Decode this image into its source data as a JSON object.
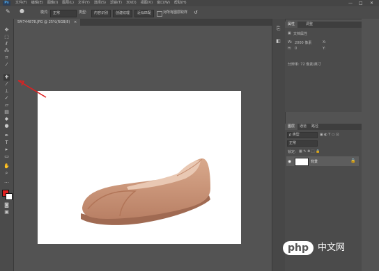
{
  "menubar": {
    "logo": "Ps",
    "items": [
      "文件(F)",
      "编辑(E)",
      "图像(I)",
      "图层(L)",
      "文字(Y)",
      "选择(S)",
      "滤镜(T)",
      "3D(D)",
      "视图(V)",
      "窗口(W)",
      "帮助(H)"
    ],
    "minimize": "—",
    "maximize": "□",
    "close": "✕"
  },
  "options": {
    "mode_label": "模式:",
    "mode_value": "正常",
    "type_label": "类型:",
    "type_value": "内容识别",
    "create_texture": "创建纹理",
    "proximity_match": "近似匹配",
    "sample_all_layers": "对所有图层取样"
  },
  "document": {
    "tab_title": "5M744878.JPG @ 25%(RGB/8)",
    "tab_close": "×"
  },
  "properties_panel": {
    "tabs": [
      "属性",
      "调整"
    ],
    "section_title": "文档属性",
    "w_label": "W:",
    "w_value": "2000 像素",
    "h_label": "H:",
    "x_label": "X:",
    "x_value": "0",
    "y_label": "Y:",
    "resolution_text": "分辨率: 72 像素/英寸"
  },
  "layers_panel": {
    "tabs": [
      "图层",
      "通道",
      "路径"
    ],
    "kind_label": "ρ 类型",
    "blend_value": "正常",
    "lock_label": "锁定:",
    "layer_name": "背景"
  },
  "watermark": {
    "logo_text": "php",
    "site_text": "中文网"
  },
  "colors": {
    "foreground": "#e02020",
    "background": "#ffffff",
    "accent_arrow": "#e02020"
  }
}
